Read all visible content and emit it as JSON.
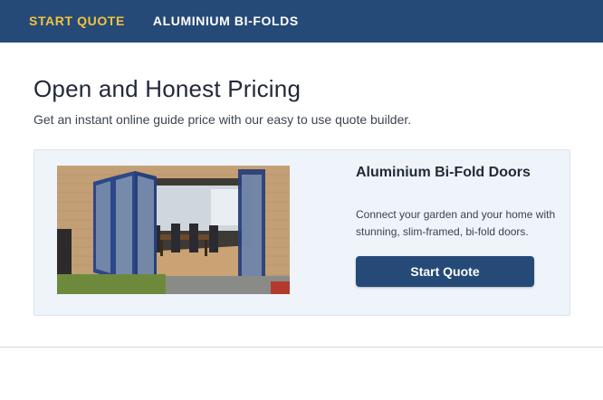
{
  "nav": {
    "items": [
      {
        "label": "START QUOTE",
        "active": true
      },
      {
        "label": "ALUMINIUM BI-FOLDS",
        "active": false
      }
    ]
  },
  "main": {
    "title": "Open and Honest Pricing",
    "subtitle": "Get an instant online guide price with our easy to use quote builder."
  },
  "card": {
    "title": "Aluminium Bi-Fold Doors",
    "description": "Connect your garden and your home with stunning, slim-framed, bi-fold doors.",
    "button_label": "Start Quote",
    "image_icon": "bifold-doors-photo"
  },
  "colors": {
    "nav_bg": "#264a78",
    "nav_active": "#f2c43a",
    "card_bg": "#eef4f9",
    "button_bg": "#264a78"
  }
}
